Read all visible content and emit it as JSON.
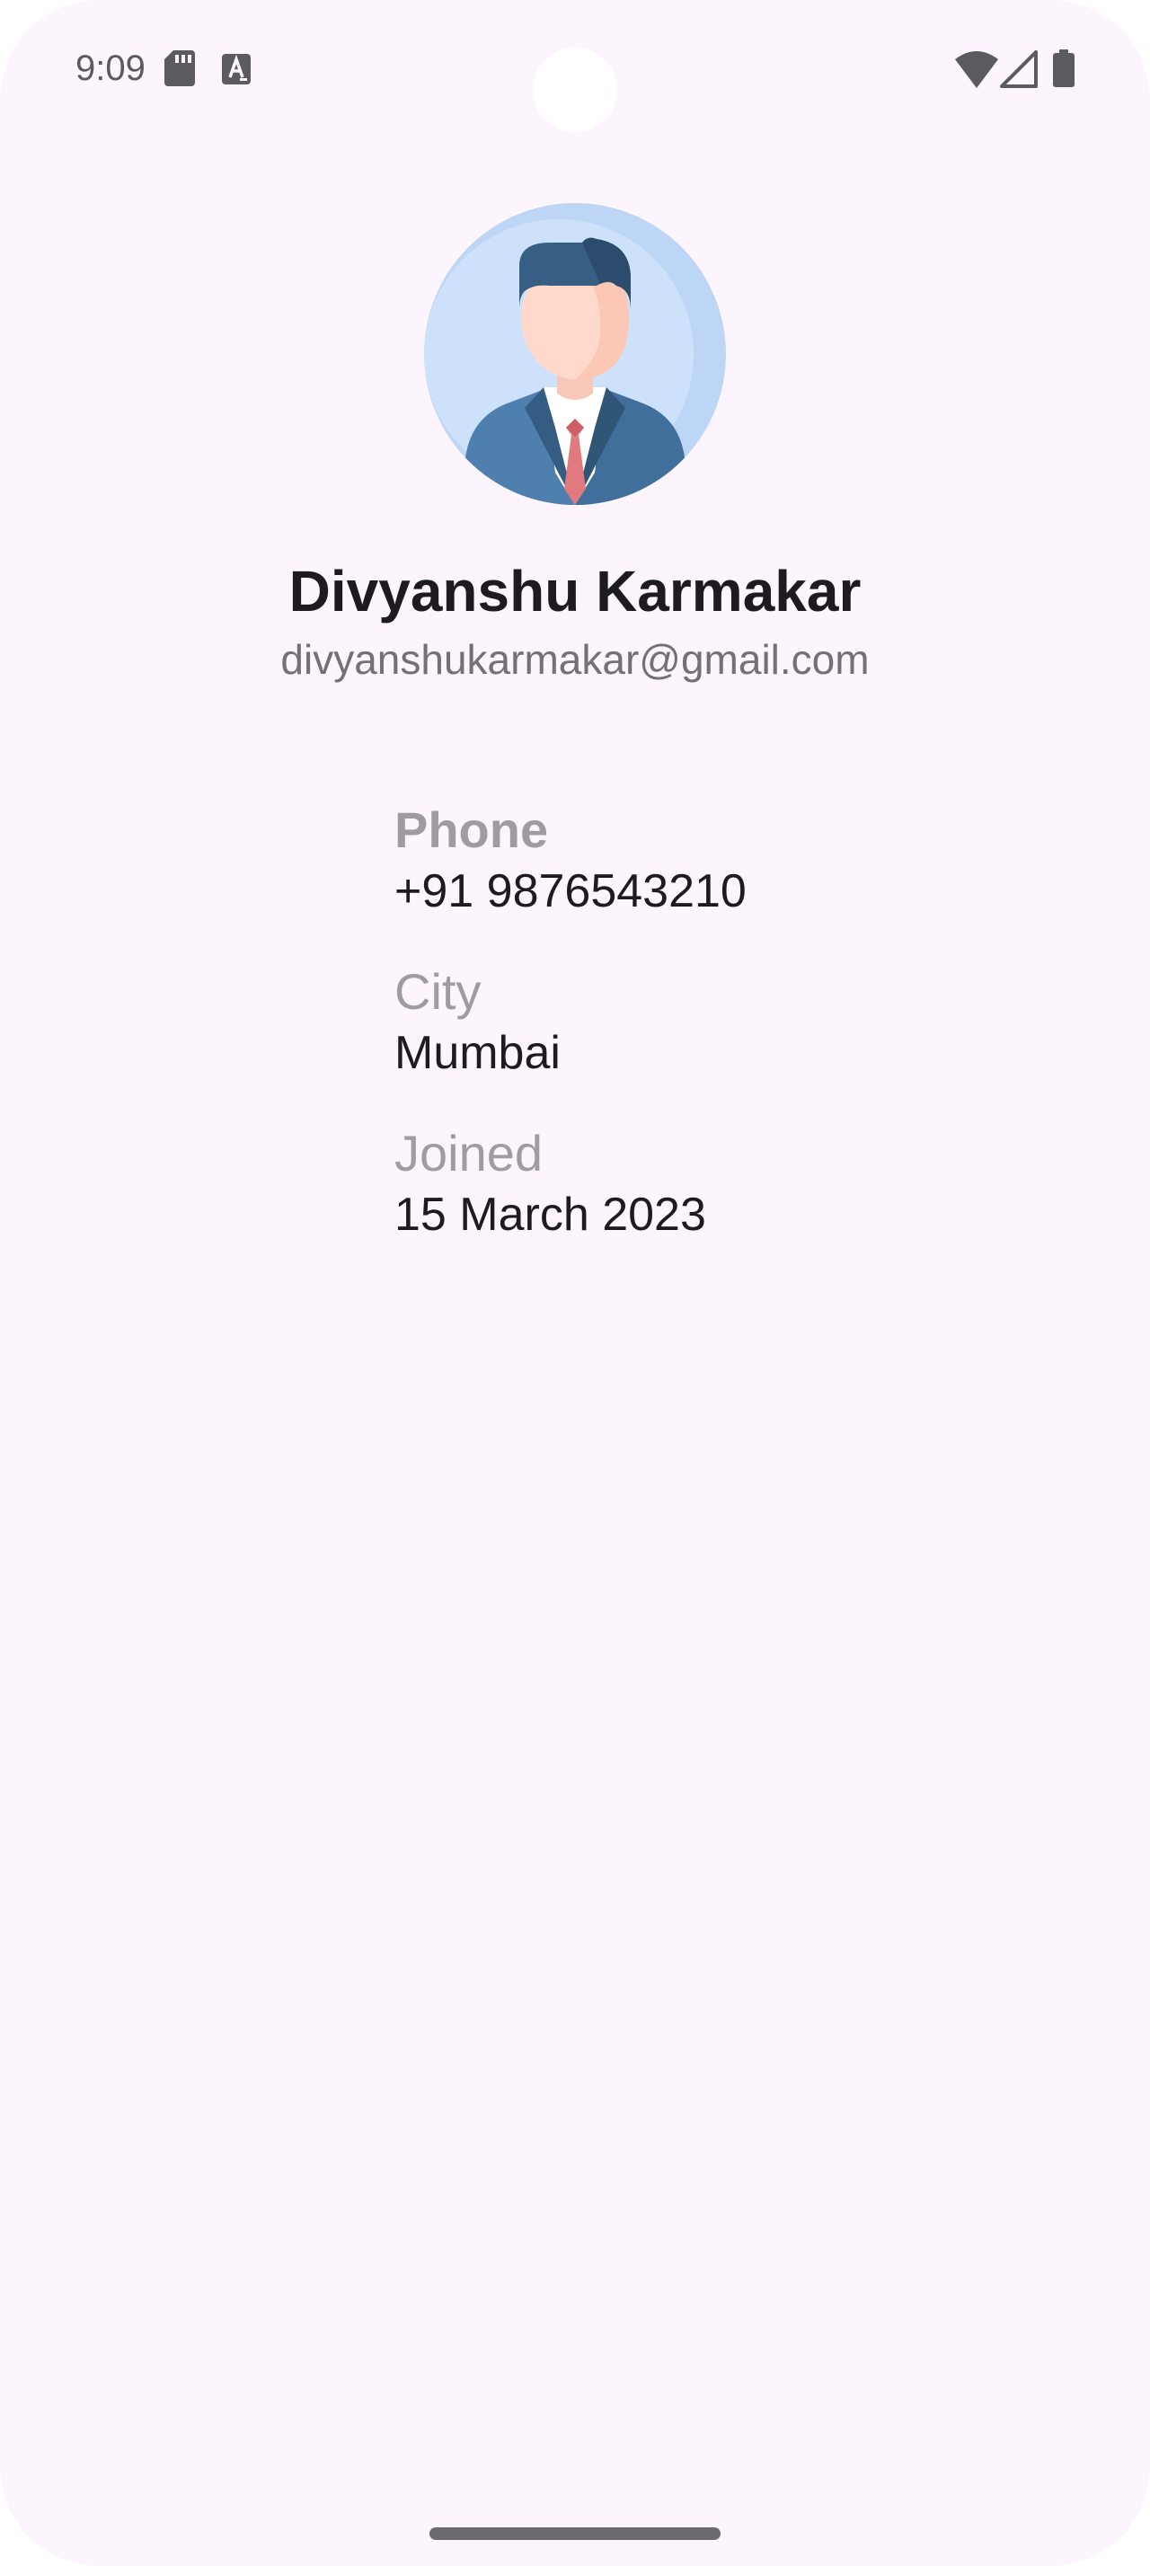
{
  "status_bar": {
    "time": "9:09",
    "icons": [
      "sd-card-icon",
      "accessibility-icon",
      "wifi-icon",
      "signal-icon",
      "battery-icon"
    ]
  },
  "profile": {
    "avatar_icon": "businessman-avatar-icon",
    "name": "Divyanshu Karmakar",
    "email": "divyanshukarmakar@gmail.com"
  },
  "details": [
    {
      "label": "Phone",
      "value": "+91 9876543210"
    },
    {
      "label": "City",
      "value": "Mumbai"
    },
    {
      "label": "Joined",
      "value": "15 March 2023"
    }
  ],
  "colors": {
    "background": "#fcf5fd",
    "text_primary": "#1d1b20",
    "text_secondary": "#737076",
    "label": "#9e9ba2"
  }
}
